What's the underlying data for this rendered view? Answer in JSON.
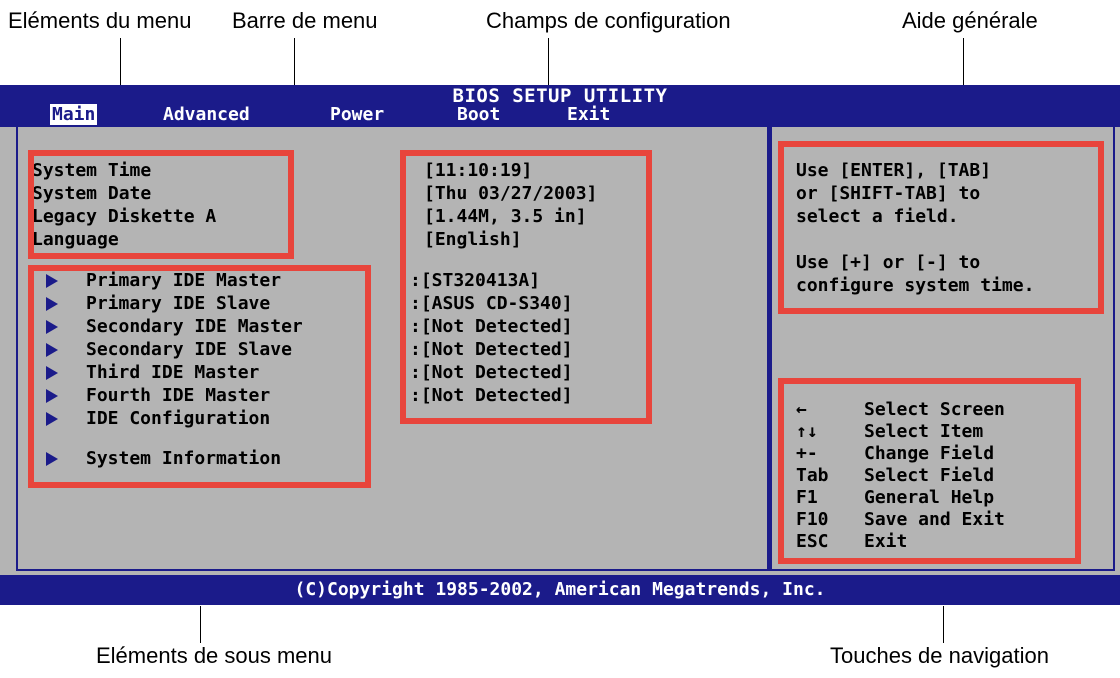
{
  "annotations": {
    "menu_items": "Eléments du menu",
    "menu_bar": "Barre de menu",
    "config_fields": "Champs de configuration",
    "general_help": "Aide générale",
    "submenu_items": "Eléments de sous menu",
    "nav_keys": "Touches de navigation"
  },
  "bios": {
    "title": "BIOS SETUP UTILITY",
    "tabs": [
      "Main",
      "Advanced",
      "Power",
      "Boot",
      "Exit"
    ],
    "active_tab": "Main",
    "items": [
      {
        "label": "System Time",
        "value": "[11:10:19]"
      },
      {
        "label": "System Date",
        "value": "[Thu 03/27/2003]"
      },
      {
        "label": "Legacy Diskette A",
        "value": "[1.44M, 3.5 in]"
      },
      {
        "label": "Language",
        "value": "[English]"
      }
    ],
    "submenus": [
      {
        "label": "Primary IDE Master",
        "value": ":[ST320413A]"
      },
      {
        "label": "Primary IDE Slave",
        "value": ":[ASUS CD-S340]"
      },
      {
        "label": "Secondary IDE Master",
        "value": ":[Not Detected]"
      },
      {
        "label": "Secondary IDE Slave",
        "value": ":[Not Detected]"
      },
      {
        "label": "Third IDE Master",
        "value": ":[Not Detected]"
      },
      {
        "label": "Fourth IDE Master",
        "value": ":[Not Detected]"
      },
      {
        "label": "IDE Configuration",
        "value": ""
      },
      {
        "label": "System Information",
        "value": ""
      }
    ],
    "help": [
      "Use [ENTER], [TAB]",
      "or [SHIFT-TAB] to",
      "select a field.",
      "",
      "Use [+] or [-] to",
      "configure system time."
    ],
    "nav": [
      {
        "key": "←",
        "desc": "Select Screen"
      },
      {
        "key": "↑↓",
        "desc": "Select Item"
      },
      {
        "key": "+-",
        "desc": "Change Field"
      },
      {
        "key": "Tab",
        "desc": "Select Field"
      },
      {
        "key": "F1",
        "desc": "General Help"
      },
      {
        "key": "F10",
        "desc": "Save and Exit"
      },
      {
        "key": "ESC",
        "desc": "Exit"
      }
    ],
    "footer": "(C)Copyright 1985-2002, American Megatrends, Inc."
  },
  "colors": {
    "bios_blue": "#1b1b8a",
    "bios_gray": "#b4b4b4",
    "highlight_red": "#e8453c"
  }
}
